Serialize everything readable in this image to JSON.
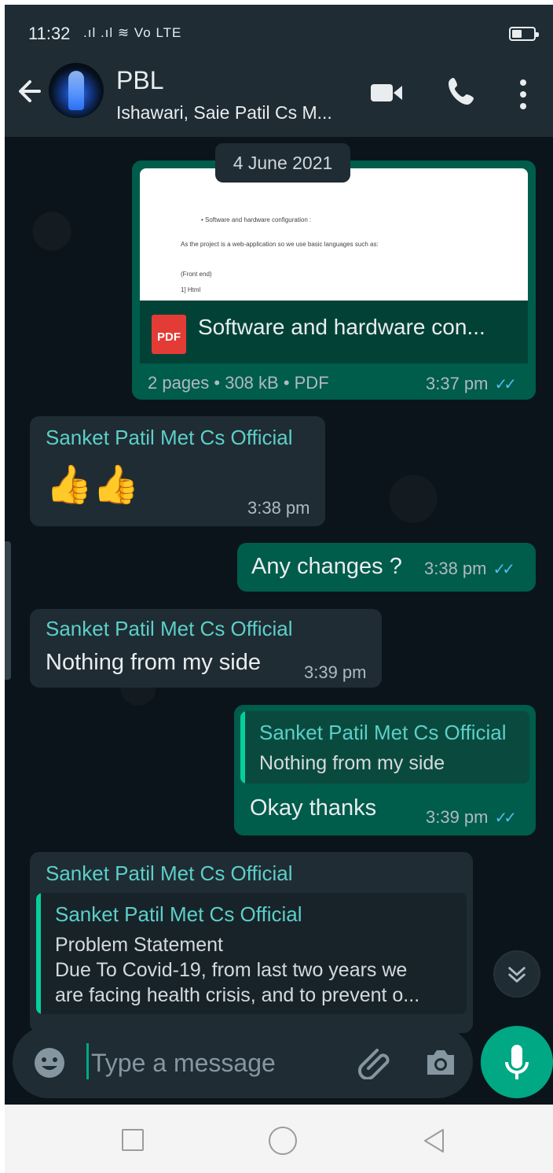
{
  "status_bar": {
    "time": "11:32",
    "indicators": ".ıl .ıl ≋ Vo LTE"
  },
  "header": {
    "title": "PBL",
    "subtitle": "Ishawari, Saie Patil Cs M..."
  },
  "chat": {
    "date": "4 June 2021",
    "document": {
      "preview_lines": [
        "• Software and hardware configuration :",
        "As the project is a web-application so we use basic languages such as:",
        "(Front end)",
        "1] Html"
      ],
      "pdf_label": "PDF",
      "title": "Software and hardware con...",
      "meta": "2 pages • 308 kB • PDF",
      "time": "3:37 pm"
    },
    "messages": [
      {
        "sender": "Sanket Patil Met Cs Official",
        "text": "👍👍",
        "time": "3:38 pm"
      },
      {
        "text": "Any changes ?",
        "time": "3:38 pm"
      },
      {
        "sender": "Sanket Patil Met Cs Official",
        "text": "Nothing from my side",
        "time": "3:39 pm"
      },
      {
        "quote_sender": "Sanket Patil Met Cs Official",
        "quote_text": "Nothing from my side",
        "text": "Okay thanks",
        "time": "3:39 pm"
      },
      {
        "sender": "Sanket Patil Met Cs Official",
        "quote_sender": "Sanket Patil Met Cs Official",
        "quote_lines": [
          "Problem Statement",
          "Due To Covid-19, from last two years we",
          "are facing health crisis, and to prevent o..."
        ]
      }
    ]
  },
  "composer": {
    "placeholder": "Type a message"
  },
  "colors": {
    "header_bg": "#1f2c34",
    "chat_bg": "#0b141a",
    "outgoing_bubble": "#005c4b",
    "incoming_bubble": "#1f2c34",
    "accent": "#00a884",
    "read_ticks": "#53bdeb",
    "sender_name": "#5ccfc8"
  },
  "icons": [
    "back-arrow-icon",
    "video-call-icon",
    "phone-icon",
    "more-vertical-icon",
    "emoji-icon",
    "attachment-icon",
    "camera-icon",
    "microphone-icon",
    "scroll-down-icon",
    "recent-apps-icon",
    "home-icon",
    "nav-back-icon"
  ]
}
